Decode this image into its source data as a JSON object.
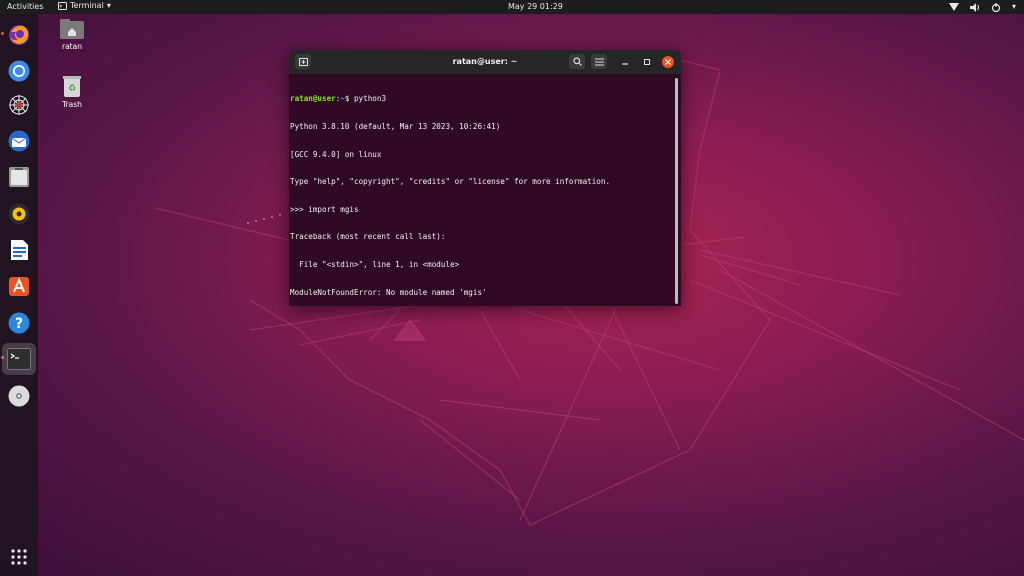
{
  "topbar": {
    "activities": "Activities",
    "app_menu": "Terminal",
    "clock": "May 29  01:29",
    "icons": [
      "network-icon",
      "volume-icon",
      "power-icon"
    ]
  },
  "dock": {
    "items": [
      {
        "name": "firefox-icon",
        "running": true
      },
      {
        "name": "chromium-icon",
        "running": false
      },
      {
        "name": "spider-web-icon",
        "running": false
      },
      {
        "name": "thunderbird-icon",
        "running": false
      },
      {
        "name": "files-icon",
        "running": false
      },
      {
        "name": "rhythmbox-icon",
        "running": false
      },
      {
        "name": "writer-icon",
        "running": false
      },
      {
        "name": "software-center-icon",
        "running": false
      },
      {
        "name": "help-icon",
        "running": false
      },
      {
        "name": "terminal-icon",
        "running": true
      },
      {
        "name": "dvd-icon",
        "running": false
      }
    ],
    "show_apps_icon": "apps-grid-icon"
  },
  "desktop": {
    "icons": [
      {
        "label": "ratan",
        "icon": "home-folder-icon"
      },
      {
        "label": "Trash",
        "icon": "trash-icon"
      }
    ]
  },
  "terminal": {
    "title": "ratan@user: ~",
    "lines": [
      {
        "user": "ratan@user",
        "sep": ":",
        "path": "~",
        "rest": "$ python3"
      },
      {
        "text": "Python 3.8.10 (default, Mar 13 2023, 10:26:41)"
      },
      {
        "text": "[GCC 9.4.0] on linux"
      },
      {
        "text": "Type \"help\", \"copyright\", \"credits\" or \"license\" for more information."
      },
      {
        "text": ">>> import mgis"
      },
      {
        "text": "Traceback (most recent call last):"
      },
      {
        "text": "  File \"<stdin>\", line 1, in <module>"
      },
      {
        "text": "ModuleNotFoundError: No module named 'mgis'"
      },
      {
        "text": ">>> "
      }
    ]
  },
  "colors": {
    "accent": "#e95420",
    "terminal_bg": "#300a24",
    "prompt_user": "#8ae234",
    "prompt_path": "#729fcf"
  }
}
